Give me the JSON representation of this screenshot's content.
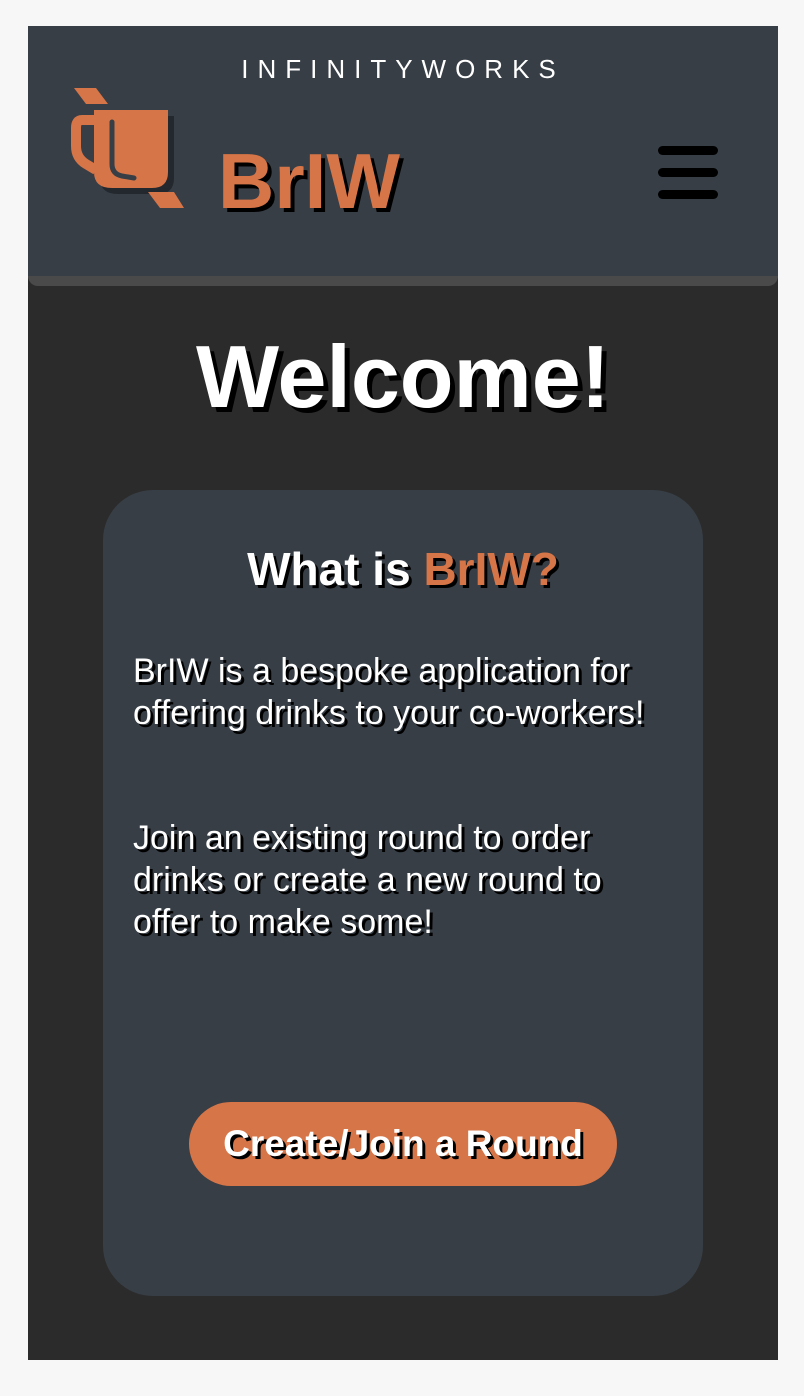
{
  "header": {
    "brand_wordmark": "INFINITYWORKS",
    "app_title": "BrIW",
    "logo_icon": "mug-icon",
    "menu_icon": "hamburger-menu-icon"
  },
  "main": {
    "heading": "Welcome!",
    "card": {
      "title_prefix": "What is ",
      "title_accent": "BrIW?",
      "paragraph_1": "BrIW is a bespoke application for offering drinks to your co-workers!",
      "paragraph_2": "Join an existing round to order drinks or create a new round to offer to make some!",
      "button_label": "Create/Join a Round"
    }
  },
  "colors": {
    "accent": "#d67547",
    "header_bg": "#373e46",
    "page_bg": "#2b2b2b",
    "text": "#ffffff"
  }
}
